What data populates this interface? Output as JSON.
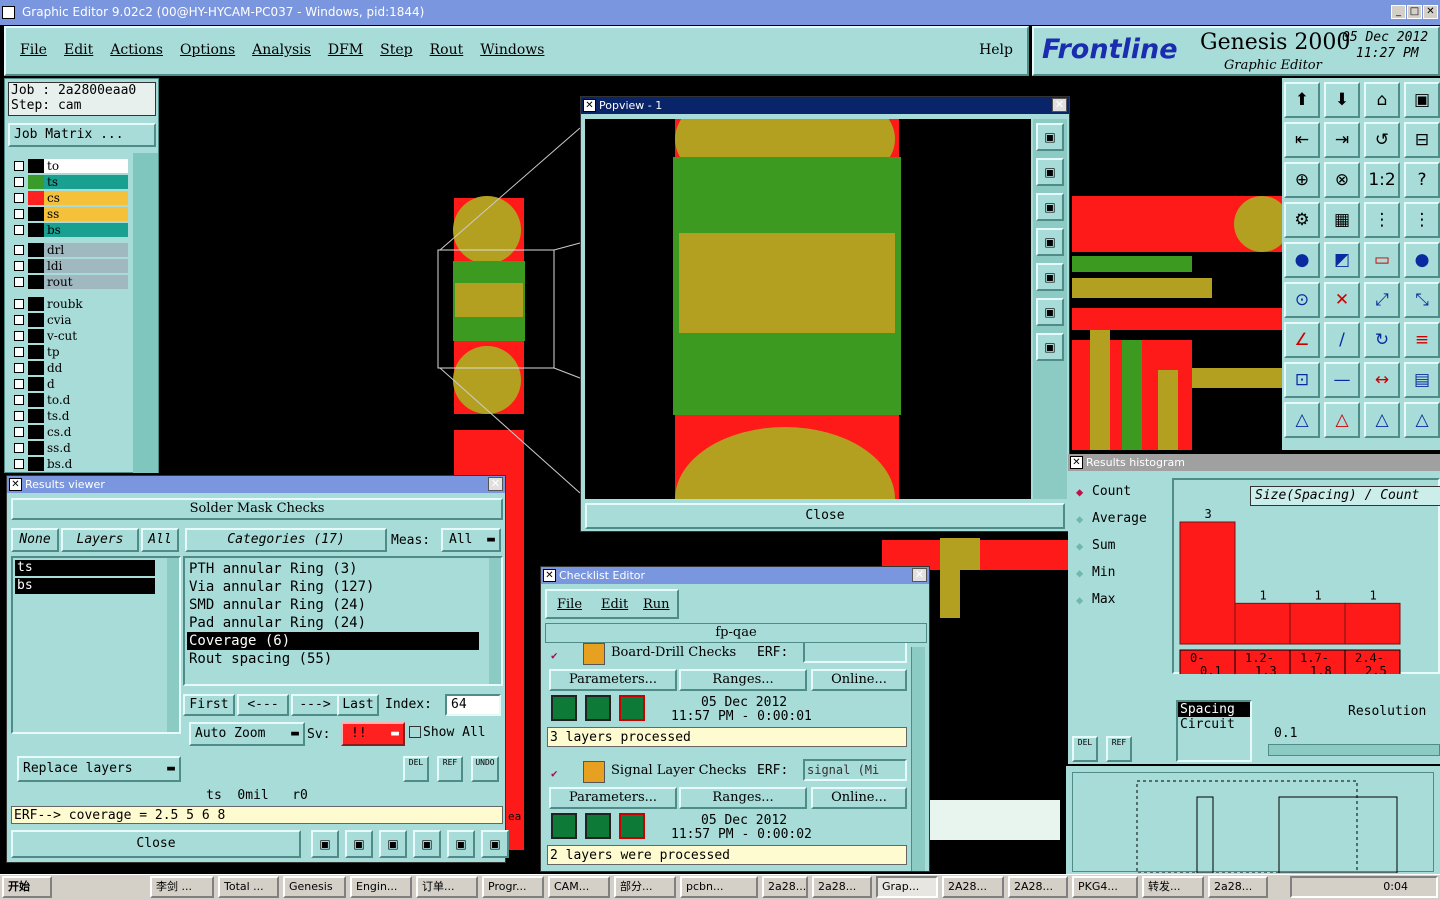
{
  "window_title": "Graphic Editor 9.02c2 (00@HY-HYCAM-PC037 - Windows, pid:1844)",
  "menu": [
    "File",
    "Edit",
    "Actions",
    "Options",
    "Analysis",
    "DFM",
    "Step",
    "Rout",
    "Windows"
  ],
  "help_label": "Help",
  "brand": {
    "logo": "Frontline",
    "product": "Genesis 2000",
    "subtitle": "Graphic Editor",
    "date": "05 Dec 2012",
    "time": "11:27 PM"
  },
  "job": {
    "job_line": "Job : 2a2800eaa0",
    "step_line": "Step: cam",
    "matrix_button": "Job Matrix ..."
  },
  "layers": [
    {
      "name": "to",
      "color": "#ffffff",
      "swatch": "#000000"
    },
    {
      "name": "ts",
      "color": "#1aa090",
      "swatch": "#3a9a2a"
    },
    {
      "name": "cs",
      "color": "#f5c03a",
      "swatch": "#ff2020"
    },
    {
      "name": "ss",
      "color": "#f5c03a",
      "swatch": "#000000"
    },
    {
      "name": "bs",
      "color": "#1aa090",
      "swatch": "#000000"
    },
    {
      "name": "drl",
      "color": "#a0b8c0",
      "swatch": "#000000"
    },
    {
      "name": "ldi",
      "color": "#a0b8c0",
      "swatch": "#000000"
    },
    {
      "name": "rout",
      "color": "#a0b8c0",
      "swatch": "#000000"
    },
    {
      "name": "roubk",
      "color": "#a8dcd8",
      "swatch": "#000000"
    },
    {
      "name": "cvia",
      "color": "#a8dcd8",
      "swatch": "#000000"
    },
    {
      "name": "v-cut",
      "color": "#a8dcd8",
      "swatch": "#000000"
    },
    {
      "name": "tp",
      "color": "#a8dcd8",
      "swatch": "#000000"
    },
    {
      "name": "dd",
      "color": "#a8dcd8",
      "swatch": "#000000"
    },
    {
      "name": "d",
      "color": "#a8dcd8",
      "swatch": "#000000"
    },
    {
      "name": "to.d",
      "color": "#a8dcd8",
      "swatch": "#000000"
    },
    {
      "name": "ts.d",
      "color": "#a8dcd8",
      "swatch": "#000000"
    },
    {
      "name": "cs.d",
      "color": "#a8dcd8",
      "swatch": "#000000"
    },
    {
      "name": "ss.d",
      "color": "#a8dcd8",
      "swatch": "#000000"
    },
    {
      "name": "bs.d",
      "color": "#a8dcd8",
      "swatch": "#000000"
    }
  ],
  "popview": {
    "title": "Popview - 1",
    "close": "Close"
  },
  "results_viewer": {
    "title": "Results viewer",
    "header": "Solder Mask Checks",
    "tabs": {
      "none": "None",
      "layers": "Layers",
      "all": "All",
      "categories": "Categories (17)",
      "meas_label": "Meas:",
      "meas_value": "All"
    },
    "layer_list": [
      "ts",
      "bs"
    ],
    "categories": [
      "PTH annular Ring (3)",
      "Via annular Ring (127)",
      "SMD annular Ring (24)",
      "Pad annular Ring (24)",
      "Coverage (6)",
      "Rout spacing (55)"
    ],
    "selected_category": "Coverage (6)",
    "nav": {
      "first": "First",
      "prev": "<---",
      "next": "--->",
      "last": "Last",
      "index_label": "Index:",
      "index_value": "64"
    },
    "auto_zoom": "Auto Zoom",
    "sv_label": "Sv:",
    "sv_value": "!!",
    "show_all": "Show All",
    "replace_layers": "Replace layers",
    "status1": "ts  0mil   r0",
    "status2": "ERF--> coverage = 2.5 5 6 8",
    "close": "Close",
    "small_btns": [
      "DEL",
      "REF",
      "UNDO"
    ]
  },
  "checklist": {
    "title": "Checklist Editor",
    "menu": [
      "File",
      "Edit",
      "Run"
    ],
    "name": "fp-qae",
    "rows": [
      {
        "title": "Board-Drill Checks",
        "erf_label": "ERF:",
        "erf_value": "",
        "params": "Parameters...",
        "ranges": "Ranges...",
        "online": "Online...",
        "date": "05 Dec 2012",
        "time": "11:57 PM - 0:00:01",
        "status": "3 layers processed"
      },
      {
        "title": "Signal Layer Checks",
        "erf_label": "ERF:",
        "erf_value": "signal (Mi",
        "params": "Parameters...",
        "ranges": "Ranges...",
        "online": "Online...",
        "date": "05 Dec 2012",
        "time": "11:57 PM - 0:00:02",
        "status": "2 layers were processed"
      }
    ]
  },
  "histogram": {
    "title": "Results histogram",
    "options": [
      "Count",
      "Average",
      "Sum",
      "Min",
      "Max"
    ],
    "selected": "Count",
    "chart_title": "Size(Spacing) / Count",
    "list": [
      "Spacing",
      "Circuit"
    ],
    "resolution_label": "Resolution",
    "resolution_value": "0.1",
    "small_btns": [
      "DEL",
      "REF"
    ]
  },
  "chart_data": {
    "type": "bar",
    "title": "Size(Spacing) / Count",
    "categories": [
      "0-0.1",
      "1.2-1.3",
      "1.7-1.8",
      "2.4-2.5"
    ],
    "values": [
      3,
      1,
      1,
      1
    ],
    "ylim": [
      0,
      3
    ]
  },
  "taskbar": {
    "start": "开始",
    "items": [
      "李剑 ...",
      "Total ...",
      "Genesis",
      "Engin...",
      "订单...",
      "Progr...",
      "CAM...",
      "部分...",
      "pcbn...",
      "2a28...",
      "2a28...",
      "Grap...",
      "2A28...",
      "2A28...",
      "PKG4...",
      "转发...",
      "2a28..."
    ],
    "clock": "0:04"
  },
  "snippet_text": "ea c"
}
